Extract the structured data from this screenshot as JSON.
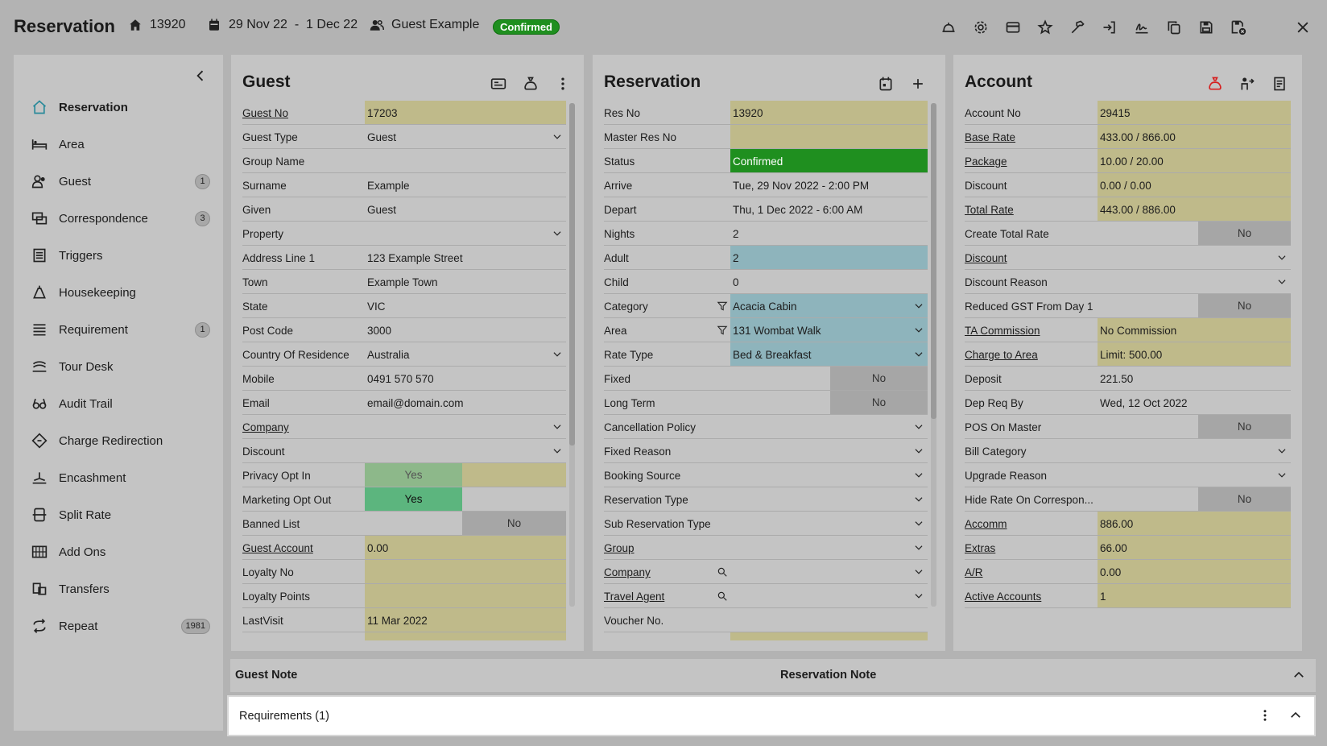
{
  "header": {
    "title": "Reservation",
    "res_no": "13920",
    "dates": "29 Nov 22  -  1 Dec 22",
    "guest_name": "Guest Example",
    "status": "Confirmed"
  },
  "sidebar": {
    "items": [
      {
        "label": "Reservation",
        "count": "",
        "icon": "home-icon"
      },
      {
        "label": "Area",
        "count": "",
        "icon": "bed-icon"
      },
      {
        "label": "Guest",
        "count": "1",
        "icon": "users-icon"
      },
      {
        "label": "Correspondence",
        "count": "3",
        "icon": "correspondence-icon"
      },
      {
        "label": "Triggers",
        "count": "",
        "icon": "triggers-icon"
      },
      {
        "label": "Housekeeping",
        "count": "",
        "icon": "housekeeping-icon"
      },
      {
        "label": "Requirement",
        "count": "1",
        "icon": "requirement-icon"
      },
      {
        "label": "Tour Desk",
        "count": "",
        "icon": "tour-desk-icon"
      },
      {
        "label": "Audit Trail",
        "count": "",
        "icon": "glasses-icon"
      },
      {
        "label": "Charge Redirection",
        "count": "",
        "icon": "diamond-icon"
      },
      {
        "label": "Encashment",
        "count": "",
        "icon": "encashment-icon"
      },
      {
        "label": "Split Rate",
        "count": "",
        "icon": "split-rate-icon"
      },
      {
        "label": "Add Ons",
        "count": "",
        "icon": "grid-icon"
      },
      {
        "label": "Transfers",
        "count": "",
        "icon": "transfers-icon"
      },
      {
        "label": "Repeat",
        "count": "1981",
        "icon": "repeat-icon"
      }
    ]
  },
  "guest_panel": {
    "title": "Guest",
    "rows": [
      {
        "label": "Guest No",
        "value": "17203"
      },
      {
        "label": "Guest Type",
        "value": "Guest"
      },
      {
        "label": "Group Name",
        "value": ""
      },
      {
        "label": "Surname",
        "value": "Example"
      },
      {
        "label": "Given",
        "value": "Guest"
      },
      {
        "label": "Property",
        "value": ""
      },
      {
        "label": "Address Line 1",
        "value": "123 Example Street"
      },
      {
        "label": "Town",
        "value": "Example Town"
      },
      {
        "label": "State",
        "value": "VIC"
      },
      {
        "label": "Post Code",
        "value": "3000"
      },
      {
        "label": "Country Of Residence",
        "value": "Australia"
      },
      {
        "label": "Mobile",
        "value": "0491 570 570"
      },
      {
        "label": "Email",
        "value": "email@domain.com"
      },
      {
        "label": "Company",
        "value": ""
      },
      {
        "label": "Discount",
        "value": ""
      },
      {
        "label": "Privacy Opt In",
        "value": "Yes"
      },
      {
        "label": "Marketing Opt Out",
        "value": "Yes"
      },
      {
        "label": "Banned List",
        "value": "No"
      },
      {
        "label": "Guest Account",
        "value": "0.00"
      },
      {
        "label": "Loyalty No",
        "value": ""
      },
      {
        "label": "Loyalty Points",
        "value": ""
      },
      {
        "label": "LastVisit",
        "value": "11 Mar 2022"
      }
    ]
  },
  "reservation_panel": {
    "title": "Reservation",
    "rows": [
      {
        "label": "Res No",
        "value": "13920"
      },
      {
        "label": "Master Res No",
        "value": ""
      },
      {
        "label": "Status",
        "value": "Confirmed"
      },
      {
        "label": "Arrive",
        "value": "Tue, 29 Nov 2022 - 2:00 PM"
      },
      {
        "label": "Depart",
        "value": "Thu, 1 Dec 2022 - 6:00 AM"
      },
      {
        "label": "Nights",
        "value": "2"
      },
      {
        "label": "Adult",
        "value": "2"
      },
      {
        "label": "Child",
        "value": "0"
      },
      {
        "label": "Category",
        "value": "Acacia Cabin"
      },
      {
        "label": "Area",
        "value": "131 Wombat Walk"
      },
      {
        "label": "Rate Type",
        "value": "Bed & Breakfast"
      },
      {
        "label": "Fixed",
        "value": "No"
      },
      {
        "label": "Long Term",
        "value": "No"
      },
      {
        "label": "Cancellation Policy",
        "value": ""
      },
      {
        "label": "Fixed Reason",
        "value": ""
      },
      {
        "label": "Booking Source",
        "value": ""
      },
      {
        "label": "Reservation Type",
        "value": ""
      },
      {
        "label": "Sub Reservation Type",
        "value": ""
      },
      {
        "label": "Group",
        "value": ""
      },
      {
        "label": "Company",
        "value": ""
      },
      {
        "label": "Travel Agent",
        "value": ""
      },
      {
        "label": "Voucher No.",
        "value": ""
      }
    ]
  },
  "account_panel": {
    "title": "Account",
    "rows": [
      {
        "label": "Account No",
        "value": "29415"
      },
      {
        "label": "Base Rate",
        "value": "433.00 / 866.00"
      },
      {
        "label": "Package",
        "value": "10.00 / 20.00"
      },
      {
        "label": "Discount",
        "value": "0.00 / 0.00"
      },
      {
        "label": "Total Rate",
        "value": "443.00 / 886.00"
      },
      {
        "label": "Create Total Rate",
        "value": "No"
      },
      {
        "label": "Discount",
        "value": ""
      },
      {
        "label": "Discount Reason",
        "value": ""
      },
      {
        "label": "Reduced GST From Day 1",
        "value": "No"
      },
      {
        "label": "TA Commission",
        "value": "No Commission"
      },
      {
        "label": "Charge to Area",
        "value": "Limit: 500.00"
      },
      {
        "label": "Deposit",
        "value": "221.50"
      },
      {
        "label": "Dep Req By",
        "value": "Wed, 12 Oct 2022"
      },
      {
        "label": "POS On Master",
        "value": "No"
      },
      {
        "label": "Bill Category",
        "value": ""
      },
      {
        "label": "Upgrade Reason",
        "value": ""
      },
      {
        "label": "Hide Rate On Correspon...",
        "value": "No"
      },
      {
        "label": "Accomm",
        "value": "886.00"
      },
      {
        "label": "Extras",
        "value": "66.00"
      },
      {
        "label": "A/R",
        "value": "0.00"
      },
      {
        "label": "Active Accounts",
        "value": "1"
      }
    ]
  },
  "notes": {
    "guest_note": "Guest Note",
    "reservation_note": "Reservation Note"
  },
  "requirements": {
    "label": "Requirements (1)"
  },
  "colors": {
    "background": "#b3b3b3",
    "panel": "#c4c4c4",
    "yellow_field": "#bfba8a",
    "green_status": "#1f8f1f",
    "blue_field": "#8eb4bc",
    "toggle": "#a6a6a6",
    "opt_in_yes": "#8db88a",
    "opt_out_yes": "#5cb57e"
  }
}
